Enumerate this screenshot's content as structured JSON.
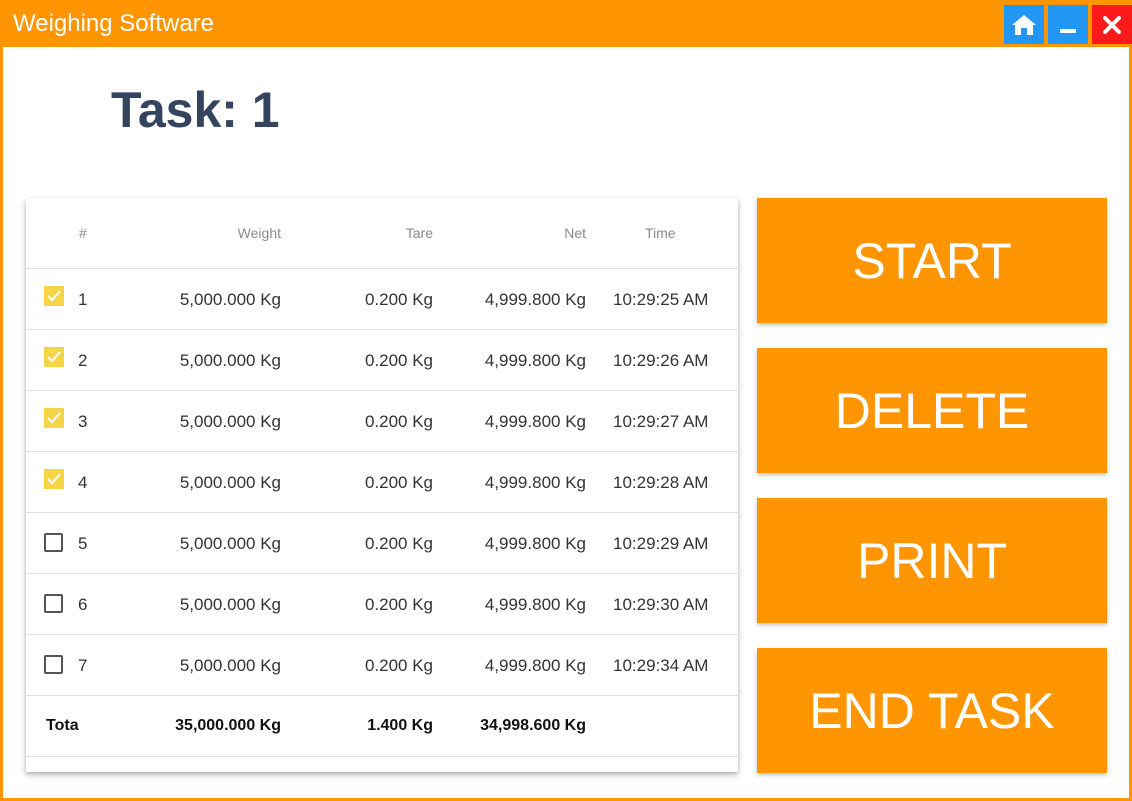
{
  "window": {
    "title": "Weighing Software",
    "buttons": [
      {
        "name": "home",
        "icon": "home-icon"
      },
      {
        "name": "minimize",
        "icon": "minimize-icon"
      },
      {
        "name": "close",
        "icon": "close-icon"
      }
    ],
    "colors": {
      "accent": "#ff9500",
      "title_button_blue": "#2196f3",
      "close_red": "#ff1a1a",
      "checkbox_checked": "#f5d547",
      "task_title": "#34445f"
    }
  },
  "task": {
    "title": "Task: 1"
  },
  "table": {
    "headers": {
      "num": "#",
      "weight": "Weight",
      "tare": "Tare",
      "net": "Net",
      "time": "Time"
    },
    "rows": [
      {
        "checked": true,
        "num": "1",
        "weight": "5,000.000 Kg",
        "tare": "0.200 Kg",
        "net": "4,999.800 Kg",
        "time": "10:29:25 AM"
      },
      {
        "checked": true,
        "num": "2",
        "weight": "5,000.000 Kg",
        "tare": "0.200 Kg",
        "net": "4,999.800 Kg",
        "time": "10:29:26 AM"
      },
      {
        "checked": true,
        "num": "3",
        "weight": "5,000.000 Kg",
        "tare": "0.200 Kg",
        "net": "4,999.800 Kg",
        "time": "10:29:27 AM"
      },
      {
        "checked": true,
        "num": "4",
        "weight": "5,000.000 Kg",
        "tare": "0.200 Kg",
        "net": "4,999.800 Kg",
        "time": "10:29:28 AM"
      },
      {
        "checked": false,
        "num": "5",
        "weight": "5,000.000 Kg",
        "tare": "0.200 Kg",
        "net": "4,999.800 Kg",
        "time": "10:29:29 AM"
      },
      {
        "checked": false,
        "num": "6",
        "weight": "5,000.000 Kg",
        "tare": "0.200 Kg",
        "net": "4,999.800 Kg",
        "time": "10:29:30 AM"
      },
      {
        "checked": false,
        "num": "7",
        "weight": "5,000.000 Kg",
        "tare": "0.200 Kg",
        "net": "4,999.800 Kg",
        "time": "10:29:34 AM"
      }
    ],
    "total": {
      "label": "Tota",
      "weight": "35,000.000 Kg",
      "tare": "1.400 Kg",
      "net": "34,998.600 Kg"
    }
  },
  "actions": {
    "start": "START",
    "delete": "DELETE",
    "print": "PRINT",
    "end_task": "END TASK"
  }
}
